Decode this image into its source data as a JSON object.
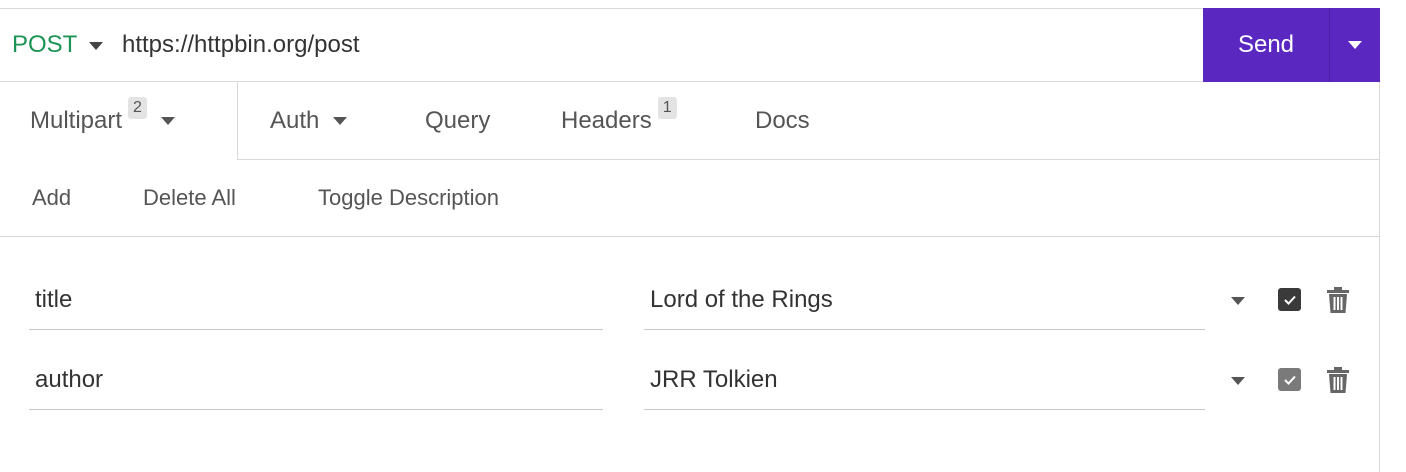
{
  "request": {
    "method": "POST",
    "url": "https://httpbin.org/post",
    "send_label": "Send"
  },
  "tabs": [
    {
      "label": "Multipart",
      "badge": "2",
      "active": true
    },
    {
      "label": "Auth"
    },
    {
      "label": "Query"
    },
    {
      "label": "Headers",
      "badge": "1"
    },
    {
      "label": "Docs"
    }
  ],
  "toolbar": {
    "add": "Add",
    "delete_all": "Delete All",
    "toggle_description": "Toggle Description"
  },
  "params": [
    {
      "name": "title",
      "value": "Lord of the Rings",
      "enabled": true
    },
    {
      "name": "author",
      "value": "JRR Tolkien",
      "enabled": true
    }
  ],
  "colors": {
    "accent": "#5b27c1",
    "method_post": "#1c9455",
    "checkbox_active": "#3a3a3a",
    "checkbox_muted": "#7a7a7a"
  },
  "icons": {
    "method_dropdown": "caret-down-icon",
    "send_dropdown": "caret-down-icon",
    "row_type": "caret-down-icon",
    "row_enabled": "checkbox-checked-icon",
    "row_delete": "trash-icon"
  }
}
